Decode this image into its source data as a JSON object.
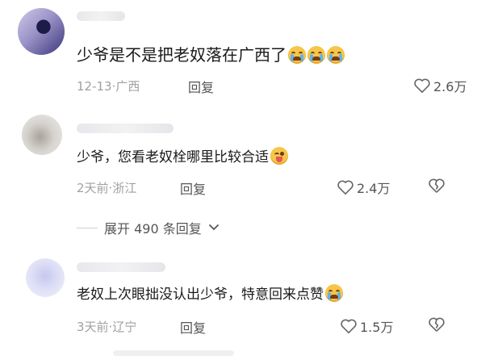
{
  "comments": [
    {
      "text": "少爷是不是把老奴落在广西了",
      "emojis": [
        "crying-face",
        "crying-face",
        "crying-face"
      ],
      "date": "12-13",
      "location": "广西",
      "reply_label": "回复",
      "likes": "2.6万"
    }
  ],
  "replies": [
    {
      "text": "少爷，您看老奴栓哪里比较合适",
      "emojis": [
        "winking-tongue-face"
      ],
      "date": "2天前",
      "location": "浙江",
      "reply_label": "回复",
      "likes": "2.4万"
    },
    {
      "text": "老奴上次眼拙没认出少爷，特意回来点赞",
      "emojis": [
        "crying-face"
      ],
      "date": "3天前",
      "location": "辽宁",
      "reply_label": "回复",
      "likes": "1.5万"
    }
  ],
  "expand": {
    "label": "展开 490 条回复"
  },
  "colors": {
    "text": "#1a1a1a",
    "meta": "#a0a0a0",
    "secondary": "#555555"
  }
}
